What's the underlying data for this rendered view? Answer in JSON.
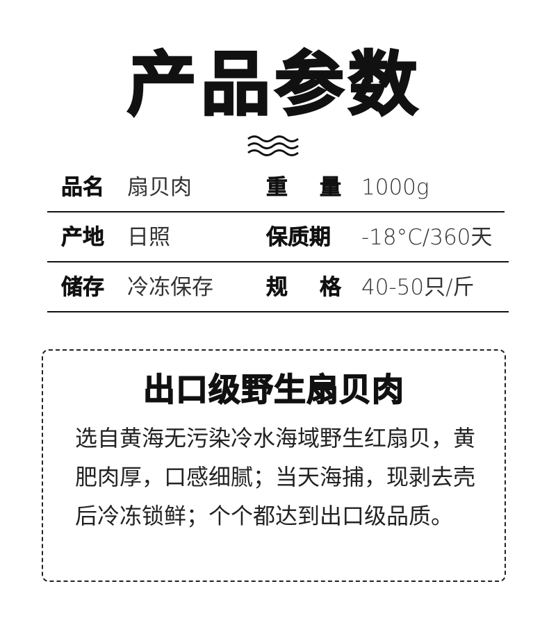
{
  "header": {
    "title": "产品参数",
    "divider_icon": "wave-lines-icon"
  },
  "params": [
    {
      "label1": "品名",
      "value1": "扇贝肉",
      "label2": [
        "重",
        "量"
      ],
      "value2": "1000g"
    },
    {
      "label1": "产地",
      "value1": "日照",
      "label2": [
        "保质期"
      ],
      "value2": "-18°C/360天"
    },
    {
      "label1": "储存",
      "value1": "冷冻保存",
      "label2": [
        "规",
        "格"
      ],
      "value2": "40-50只/斤"
    }
  ],
  "feature": {
    "title": "出口级野生扇贝肉",
    "body": "选自黄海无污染冷水海域野生红扇贝，黄肥肉厚，口感细腻；当天海捕，现剥去壳后冷冻锁鲜；个个都达到出口级品质。"
  }
}
